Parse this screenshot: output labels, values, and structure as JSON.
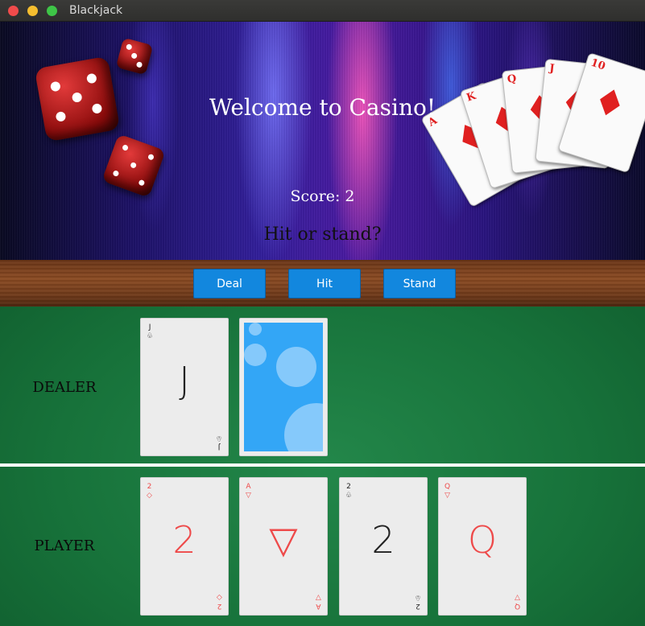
{
  "window": {
    "title": "Blackjack"
  },
  "header": {
    "welcome": "Welcome to Casino!",
    "score": "Score: 2",
    "prompt": "Hit or stand?"
  },
  "controls": {
    "deal_label": "Deal",
    "hit_label": "Hit",
    "stand_label": "Stand"
  },
  "dealer": {
    "label": "DEALER",
    "cards": [
      {
        "rank": "J",
        "suit": "clubs",
        "suit_glyph": "♧",
        "color": "black",
        "face_up": true
      },
      {
        "face_up": false
      }
    ]
  },
  "player": {
    "label": "PLAYER",
    "cards": [
      {
        "rank": "2",
        "suit": "diamonds",
        "suit_glyph": "◇",
        "color": "red"
      },
      {
        "rank": "A",
        "suit": "hearts",
        "suit_glyph": "▽",
        "color": "red"
      },
      {
        "rank": "2",
        "suit": "clubs",
        "suit_glyph": "♧",
        "color": "black"
      },
      {
        "rank": "Q",
        "suit": "hearts",
        "suit_glyph": "▽",
        "color": "red"
      }
    ]
  },
  "decor": {
    "fan_ranks": [
      "A",
      "K",
      "Q",
      "J",
      "10"
    ],
    "fan_suit_glyph": "♦"
  },
  "colors": {
    "button": "#1287de",
    "felt": "#17723a",
    "card_red": "#ee4a4a",
    "card_black": "#222222",
    "card_back": "#33a6f6"
  },
  "icons": {
    "close": "close-icon",
    "minimize": "minimize-icon",
    "maximize": "maximize-icon",
    "dice": "dice-icon",
    "cards_fan": "playing-cards-icon"
  }
}
